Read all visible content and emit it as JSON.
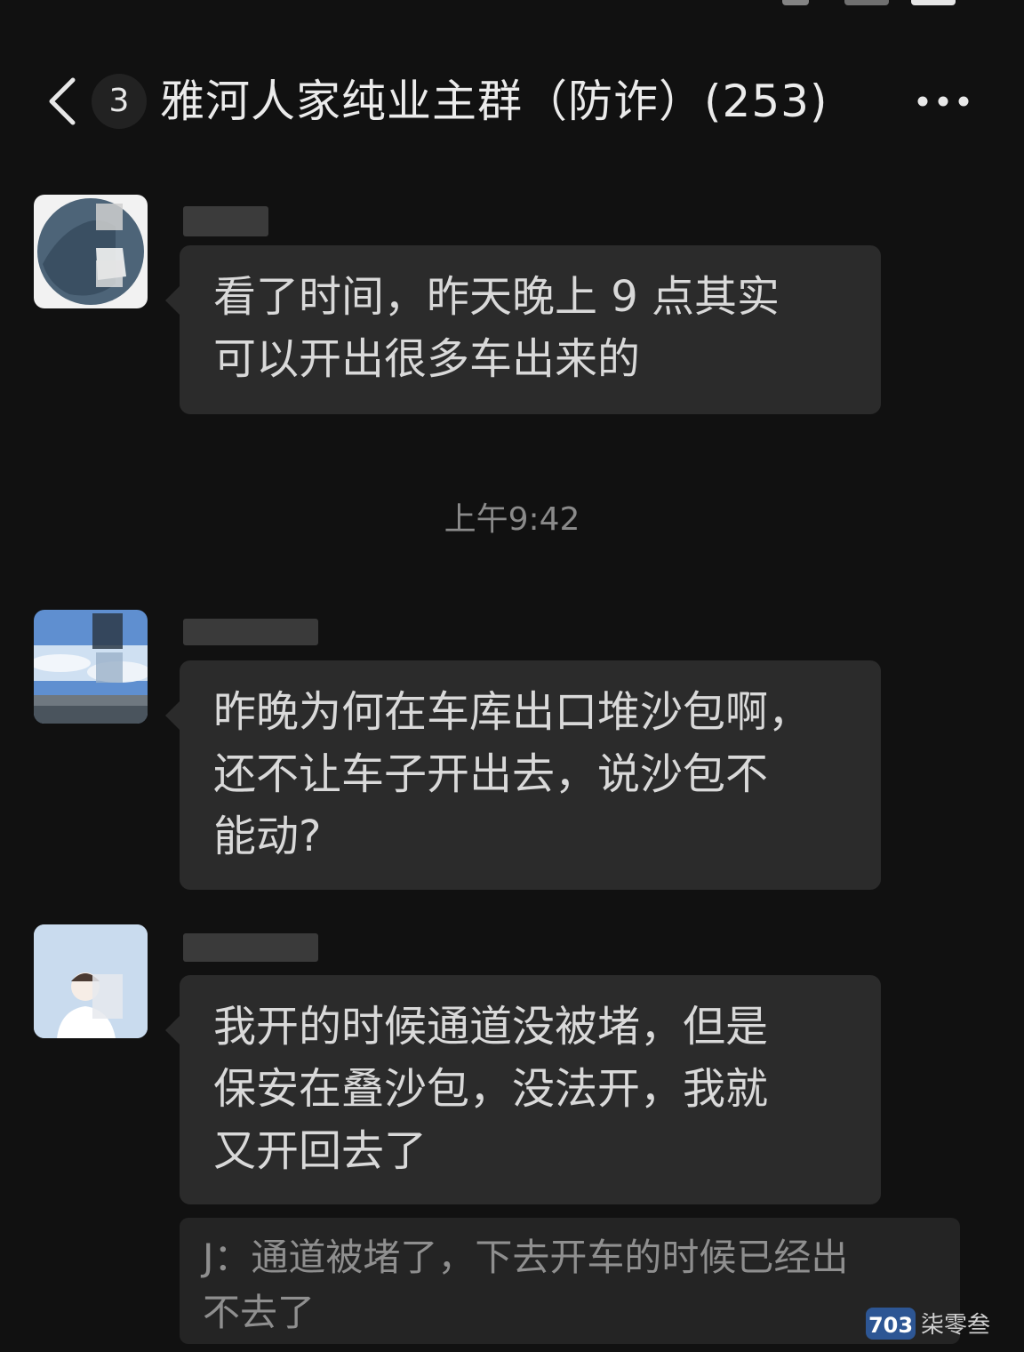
{
  "header": {
    "unread_count": "3",
    "title": "雅河人家纯业主群（防诈）(253)"
  },
  "messages": [
    {
      "text": "看了时间，昨天晚上 9 点其实\n可以开出很多车出来的"
    },
    {
      "text": "昨晚为何在车库出口堆沙包啊，\n还不让车子开出去，说沙包不\n能动?"
    },
    {
      "text": "我开的时候通道没被堵，但是\n保安在叠沙包，没法开，我就\n又开回去了"
    }
  ],
  "timestamp": "上午9:42",
  "quote": {
    "text": "J：通道被堵了，下去开车的时候已经出\n不去了"
  },
  "watermark": {
    "brand": "柒零叁",
    "code": "703"
  },
  "colors": {
    "background": "#111111",
    "bubble": "#2b2b2b",
    "quote_bg": "#242424",
    "text": "#d9d9d9",
    "muted_text": "#8a8a8a"
  }
}
